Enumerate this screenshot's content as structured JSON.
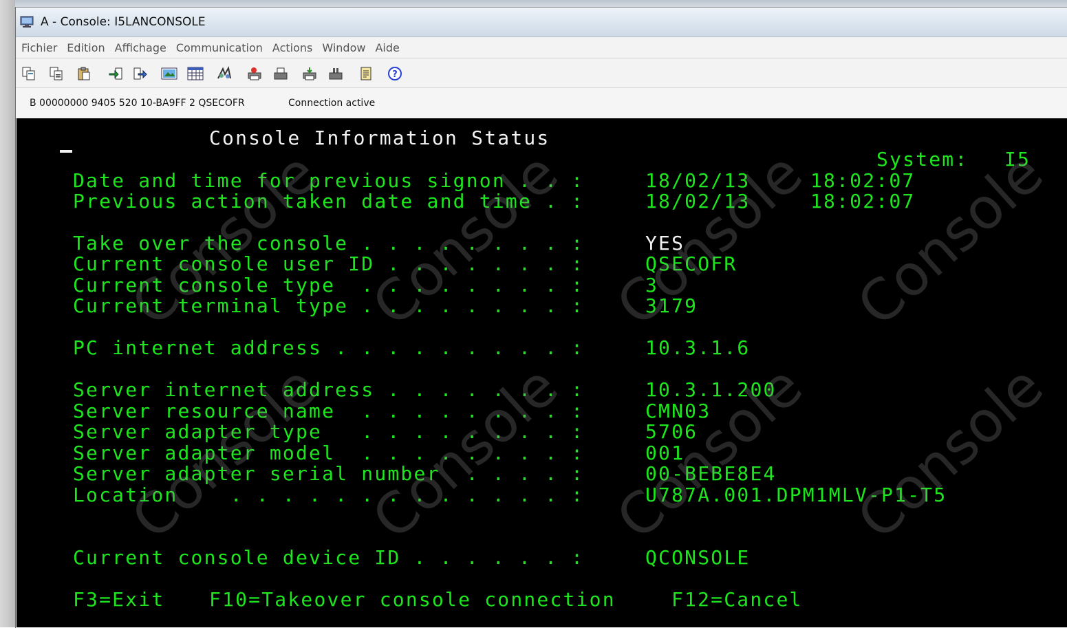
{
  "window": {
    "title": "A - Console: I5LANCONSOLE"
  },
  "menu": [
    "Fichier",
    "Edition",
    "Affichage",
    "Communication",
    "Actions",
    "Window",
    "Aide"
  ],
  "toolbar": {
    "icons": [
      "copy-icon",
      "copy-append-icon",
      "paste-icon",
      "send-icon",
      "receive-icon",
      "image-icon",
      "table-icon",
      "macro-icon",
      "print-screen-icon",
      "print-icon",
      "print-setup-icon",
      "print-queue-icon",
      "notes-icon",
      "help-icon"
    ]
  },
  "status": {
    "session_info": "B 00000000 9405 520 10-BA9FF 2 QSECOFR",
    "connection": "Connection active"
  },
  "screen": {
    "title": "Console Information Status",
    "system_label": "System:",
    "system_value": "I5",
    "rows": [
      {
        "label": "Date and time for previous signon . . :",
        "value": "18/02/13",
        "value2": "18:02:07"
      },
      {
        "label": "Previous action taken date and time . :",
        "value": "18/02/13",
        "value2": "18:02:07"
      },
      {
        "label": "Take over the console . . . . . . . . :",
        "value": "YES"
      },
      {
        "label": "Current console user ID . . . . . . . :",
        "value": "QSECOFR"
      },
      {
        "label": "Current console type  . . . . . . . . :",
        "value": "3"
      },
      {
        "label": "Current terminal type . . . . . . . . :",
        "value": "3179"
      },
      {
        "label": "PC internet address . . . . . . . . . :",
        "value": "10.3.1.6"
      },
      {
        "label": "Server internet address . . . . . . . :",
        "value": "10.3.1.200"
      },
      {
        "label": "Server resource name  . . . . . . . . :",
        "value": "CMN03"
      },
      {
        "label": "Server adapter type   . . . . . . . . :",
        "value": "5706"
      },
      {
        "label": "Server adapter model  . . . . . . . . :",
        "value": "001"
      },
      {
        "label": "Server adapter serial number  . . . . :",
        "value": "00-BEBE8E4"
      },
      {
        "label": "Location    . . . . . . . . . . . . . :",
        "value": "U787A.001.DPM1MLV-P1-T5"
      },
      {
        "label": "Current console device ID . . . . . . :",
        "value": "QCONSOLE"
      }
    ],
    "function_keys": [
      "F3=Exit",
      "F10=Takeover console connection",
      "F12=Cancel"
    ],
    "watermark": "Console"
  },
  "colors": {
    "terminal_bg": "#000000",
    "terminal_green": "#1ee61e",
    "terminal_white": "#f2f2f2"
  }
}
